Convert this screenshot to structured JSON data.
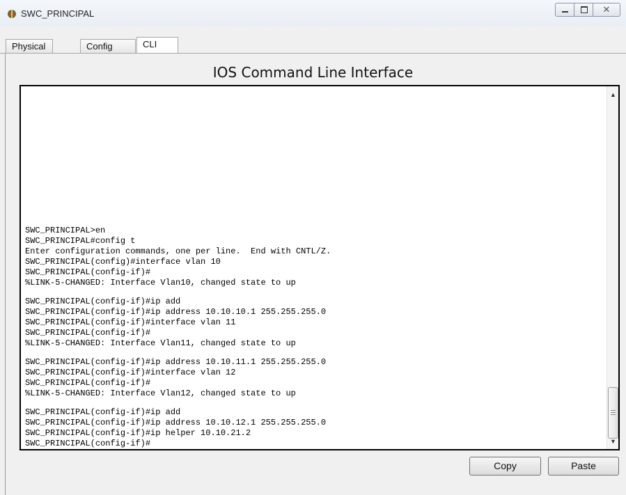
{
  "window": {
    "title": "SWC_PRINCIPAL",
    "icon": "router-icon",
    "close_glyph": "✕"
  },
  "tabs": [
    {
      "label": "Physical",
      "active": false
    },
    {
      "label": "Config",
      "active": false
    },
    {
      "label": "CLI",
      "active": true
    }
  ],
  "heading": "IOS Command Line Interface",
  "console": {
    "lines": [
      "SWC_PRINCIPAL>en",
      "SWC_PRINCIPAL#config t",
      "Enter configuration commands, one per line.  End with CNTL/Z.",
      "SWC_PRINCIPAL(config)#interface vlan 10",
      "SWC_PRINCIPAL(config-if)#",
      "%LINK-5-CHANGED: Interface Vlan10, changed state to up",
      "",
      "SWC_PRINCIPAL(config-if)#ip add",
      "SWC_PRINCIPAL(config-if)#ip address 10.10.10.1 255.255.255.0",
      "SWC_PRINCIPAL(config-if)#interface vlan 11",
      "SWC_PRINCIPAL(config-if)#",
      "%LINK-5-CHANGED: Interface Vlan11, changed state to up",
      "",
      "SWC_PRINCIPAL(config-if)#ip address 10.10.11.1 255.255.255.0",
      "SWC_PRINCIPAL(config-if)#interface vlan 12",
      "SWC_PRINCIPAL(config-if)#",
      "%LINK-5-CHANGED: Interface Vlan12, changed state to up",
      "",
      "SWC_PRINCIPAL(config-if)#ip add",
      "SWC_PRINCIPAL(config-if)#ip address 10.10.12.1 255.255.255.0",
      "SWC_PRINCIPAL(config-if)#ip helper 10.10.21.2",
      "SWC_PRINCIPAL(config-if)#"
    ]
  },
  "buttons": {
    "copy": "Copy",
    "paste": "Paste"
  }
}
